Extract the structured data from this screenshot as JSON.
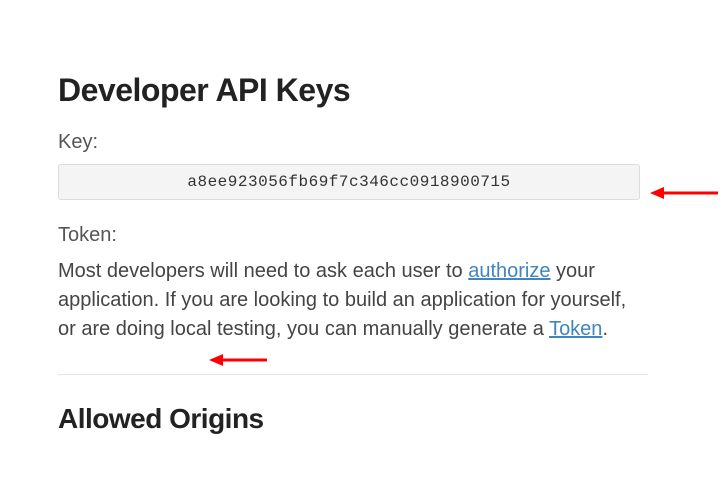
{
  "heading_main": "Developer API Keys",
  "key_label": "Key:",
  "key_value": "a8ee923056fb69f7c346cc0918900715",
  "token_label": "Token:",
  "paragraph": {
    "part1": "Most developers will need to ask each user to ",
    "link1": "authorize",
    "part2": " your application. If you are looking to build an application for yourself, or are doing local testing, you can manually generate a ",
    "link2": "Token",
    "part3": "."
  },
  "heading_sub": "Allowed Origins"
}
